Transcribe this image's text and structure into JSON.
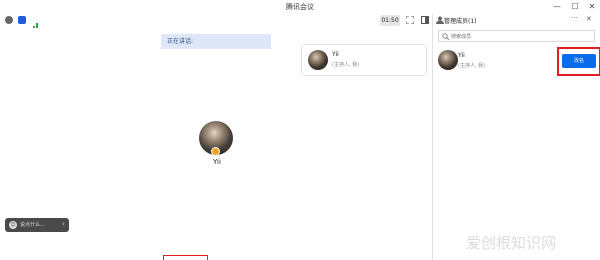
{
  "window": {
    "title": "腾讯会议",
    "controls": {
      "minimize": "—",
      "maximize": "☐",
      "close": "✕"
    }
  },
  "toolbar": {
    "info_icon": "info-icon",
    "shield_icon": "shield-icon",
    "signal_icon": "signal-icon",
    "timer": "01:50",
    "fullscreen_icon": "fullscreen-icon",
    "layout_icon": "layout-icon"
  },
  "main": {
    "speaking_label": "正在讲话:",
    "tile": {
      "name": "Yii",
      "role": "(主持人, 我)"
    },
    "center_name": "Yii"
  },
  "chat": {
    "placeholder": "说点什么...",
    "collapse_arrow": "‹"
  },
  "panel": {
    "title": "管理成员(1)",
    "more": "···",
    "close": "✕",
    "search_placeholder": "搜索成员",
    "members": [
      {
        "name": "Yii",
        "role": "(主持人, 我)",
        "action": "改名"
      }
    ]
  },
  "watermark": "爱创根知识网",
  "colors": {
    "accent": "#0a6ce8",
    "highlight": "#e02020",
    "speaking_bg": "#dde7f7"
  }
}
